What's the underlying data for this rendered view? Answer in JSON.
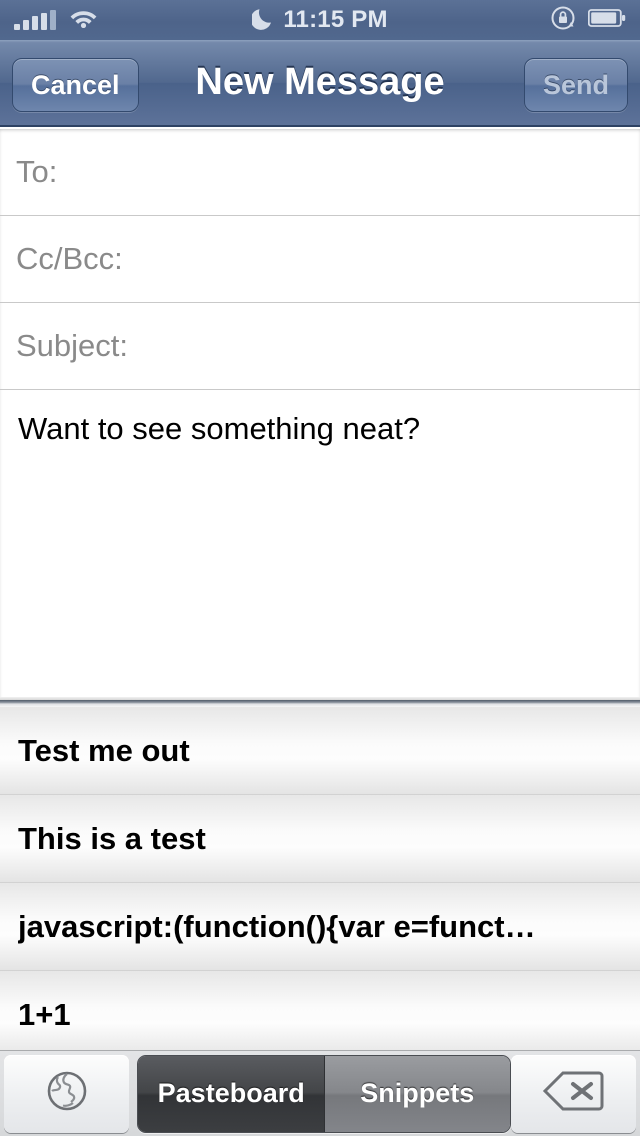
{
  "status_bar": {
    "signal_icon": "signal-bars-icon",
    "wifi_icon": "wifi-icon",
    "dnd_icon": "moon-icon",
    "time": "11:15 PM",
    "rotation_lock_icon": "rotation-lock-icon",
    "battery_icon": "battery-icon"
  },
  "nav_bar": {
    "cancel_label": "Cancel",
    "title": "New Message",
    "send_label": "Send"
  },
  "compose": {
    "fields": [
      {
        "label": "To:",
        "value": ""
      },
      {
        "label": "Cc/Bcc:",
        "value": ""
      },
      {
        "label": "Subject:",
        "value": ""
      }
    ],
    "body": "Want to see something neat?"
  },
  "snippet_list": {
    "rows": [
      {
        "label": "Test me out"
      },
      {
        "label": "This is a test"
      },
      {
        "label": "javascript:(function(){var e=funct…"
      },
      {
        "label": "1+1"
      }
    ]
  },
  "keyboard_toolbar": {
    "globe_icon": "globe-icon",
    "segments": [
      {
        "label": "Pasteboard",
        "selected": true
      },
      {
        "label": "Snippets",
        "selected": false
      }
    ],
    "delete_icon": "backspace-delete-icon"
  },
  "colors": {
    "nav_blue": "#51688e",
    "status_blue": "#4e648a",
    "placeholder_gray": "#8a8a8a",
    "segment_selected": "#3a3c3f",
    "segment_unselected": "#85878b"
  }
}
